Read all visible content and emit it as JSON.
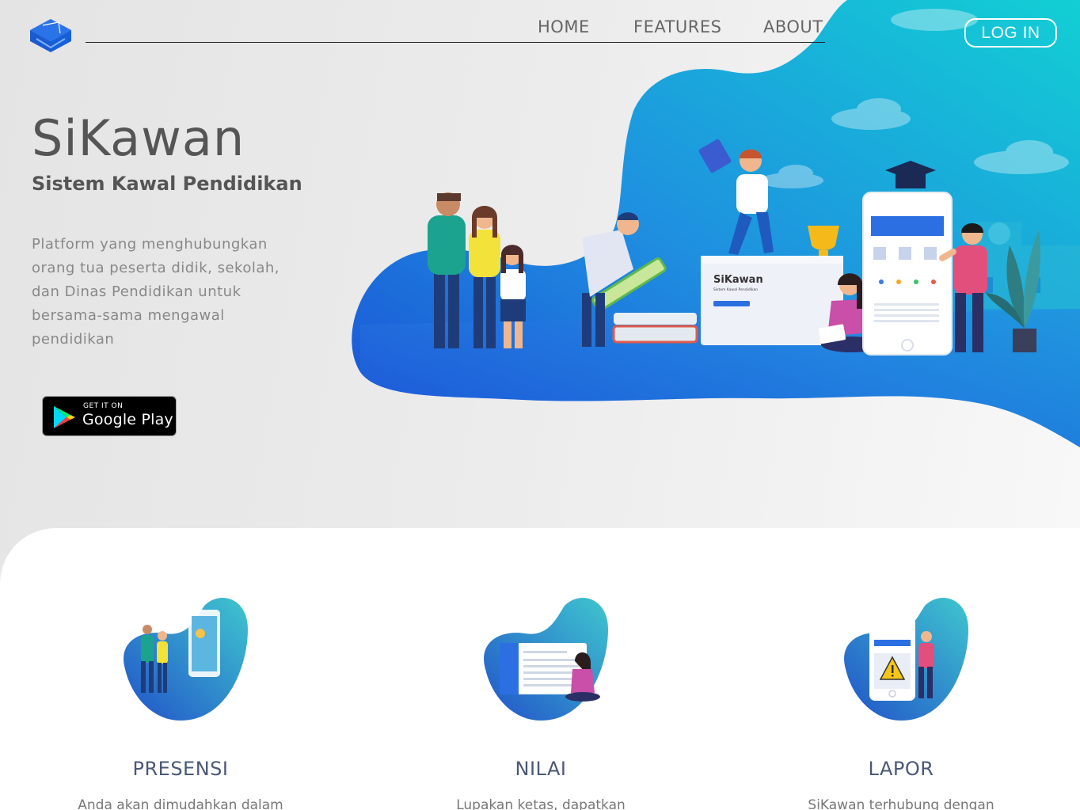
{
  "nav": {
    "home": "HOME",
    "features": "FEATURES",
    "about": "ABOUT",
    "login": "LOG IN"
  },
  "hero": {
    "title": "SiKawan",
    "subtitle": "Sistem Kawal Pendidikan",
    "description": "Platform yang menghubungkan orang tua peserta didik, sekolah, dan Dinas Pendidikan untuk bersama-sama mengawal pendidikan",
    "store_badge": {
      "small": "GET IT ON",
      "big": "Google Play"
    },
    "screen_title": "SiKawan",
    "screen_subtitle": "Sistem Kawal Pendidikan"
  },
  "features": [
    {
      "name": "PRESENSI",
      "desc": "Anda akan dimudahkan dalam"
    },
    {
      "name": "NILAI",
      "desc": "Lupakan ketas, dapatkan"
    },
    {
      "name": "LAPOR",
      "desc": "SiKawan terhubung dengan"
    }
  ],
  "colors": {
    "accent_blue": "#1e63d9",
    "accent_teal": "#16c3d4",
    "text_dark": "#555555",
    "feature_title": "#4a5878"
  }
}
